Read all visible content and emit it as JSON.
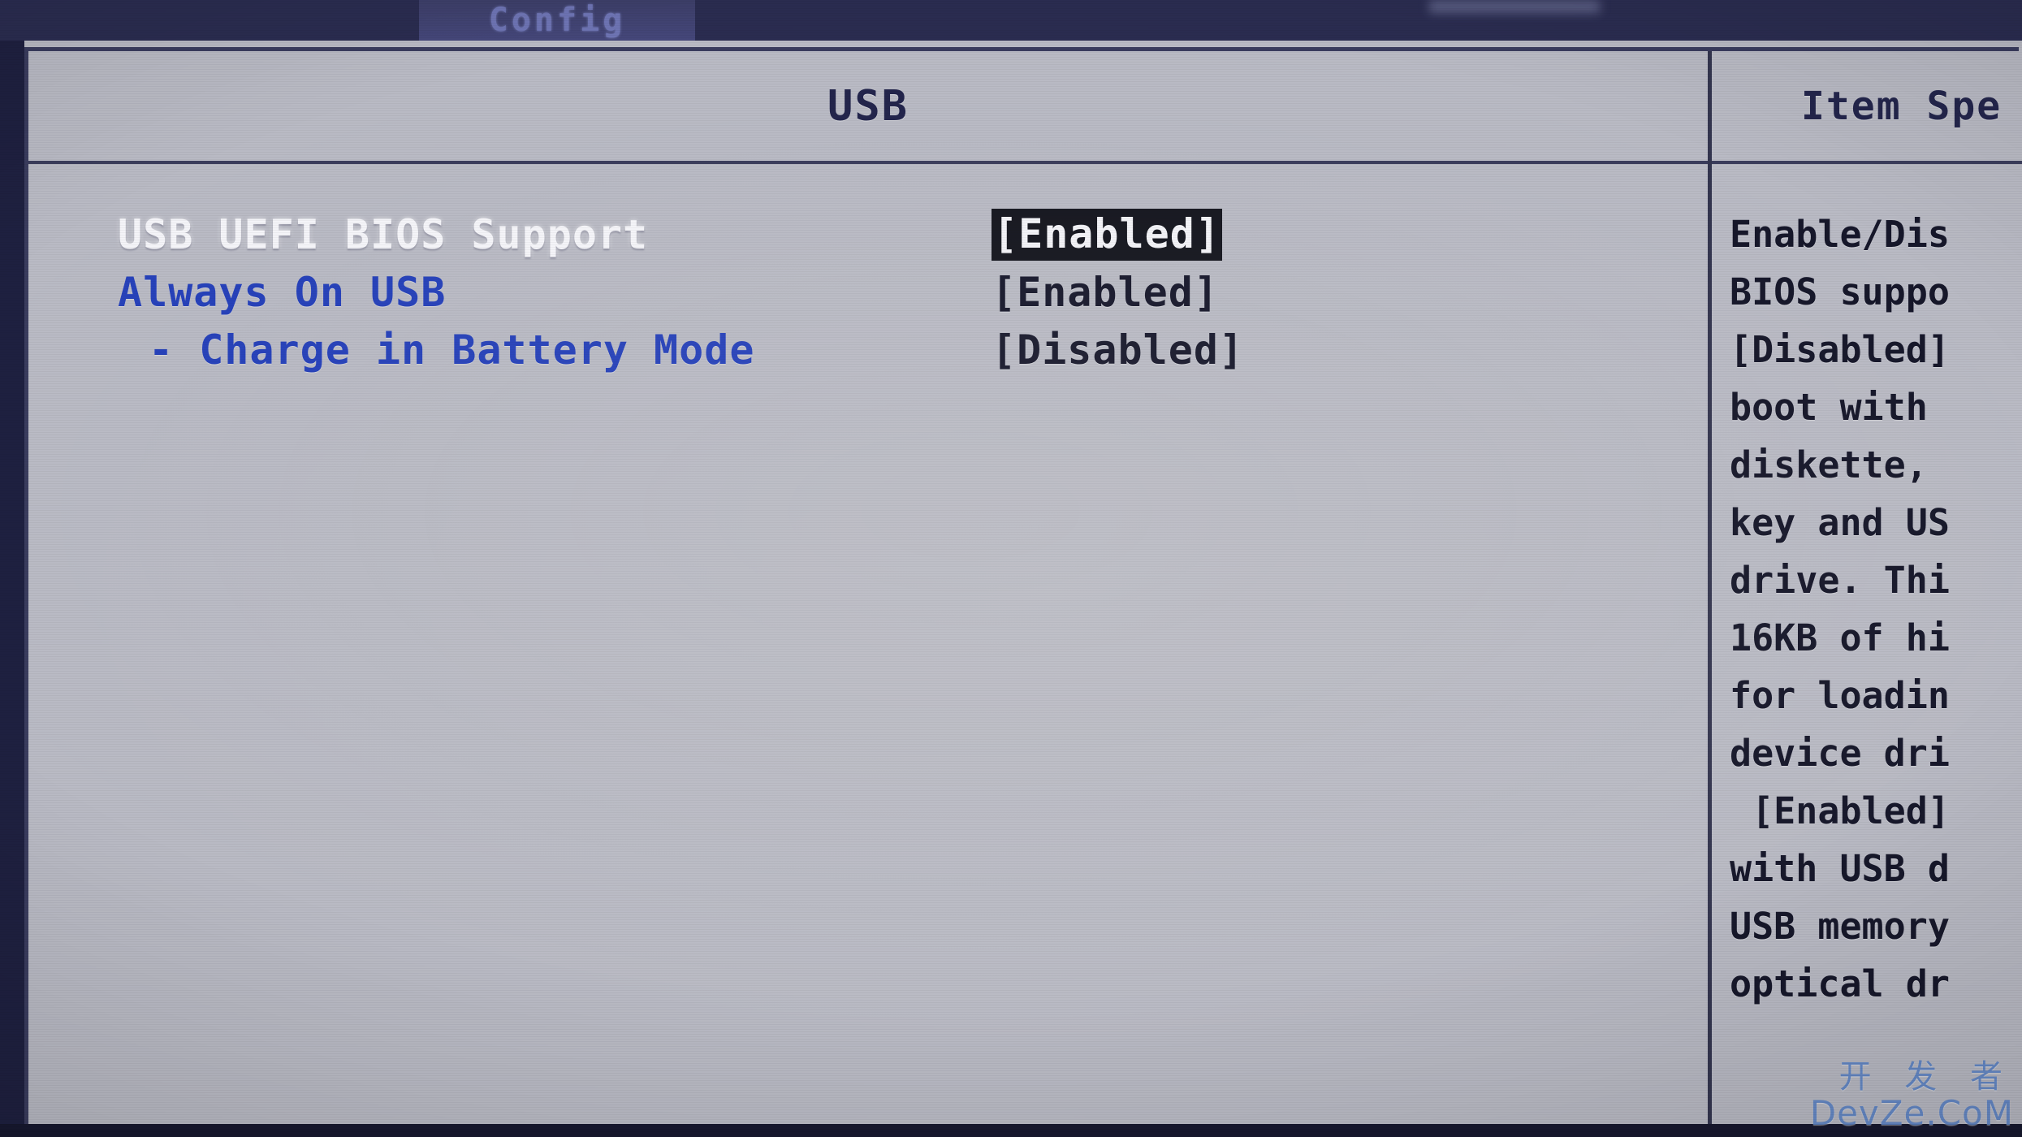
{
  "screen": {
    "kind": "bios-setup-utility",
    "accent_blue": "#2742ba",
    "title_navy": "#23254c",
    "selection_bg": "#15161f",
    "selection_fg": "#f2f2f6",
    "panel_bg": "#b9bac4",
    "menubar_bg": "#2b2d52"
  },
  "menubar": {
    "tabs": [
      {
        "label": "Config",
        "active": true
      }
    ]
  },
  "main": {
    "title": "USB",
    "rows": [
      {
        "label": "USB UEFI BIOS Support",
        "value": "[Enabled]",
        "selected": true,
        "indent": 0,
        "label_style": "white"
      },
      {
        "label": "Always On USB",
        "value": "[Enabled]",
        "selected": false,
        "indent": 1,
        "label_style": "blue"
      },
      {
        "label": "- Charge in Battery Mode",
        "value": "[Disabled]",
        "selected": false,
        "indent": 2,
        "label_style": "blue"
      }
    ]
  },
  "help": {
    "title": "Item Spe",
    "lines": [
      "Enable/Dis",
      "BIOS suppo",
      "[Disabled]",
      "boot with",
      "diskette,",
      "key and US",
      "drive. Thi",
      "16KB of hi",
      "for loadin",
      "device dri",
      " [Enabled]",
      "with USB d",
      "USB memory",
      "optical dr"
    ]
  },
  "watermark": {
    "cn": "开 发 者",
    "en": "DevZe.CoM"
  }
}
